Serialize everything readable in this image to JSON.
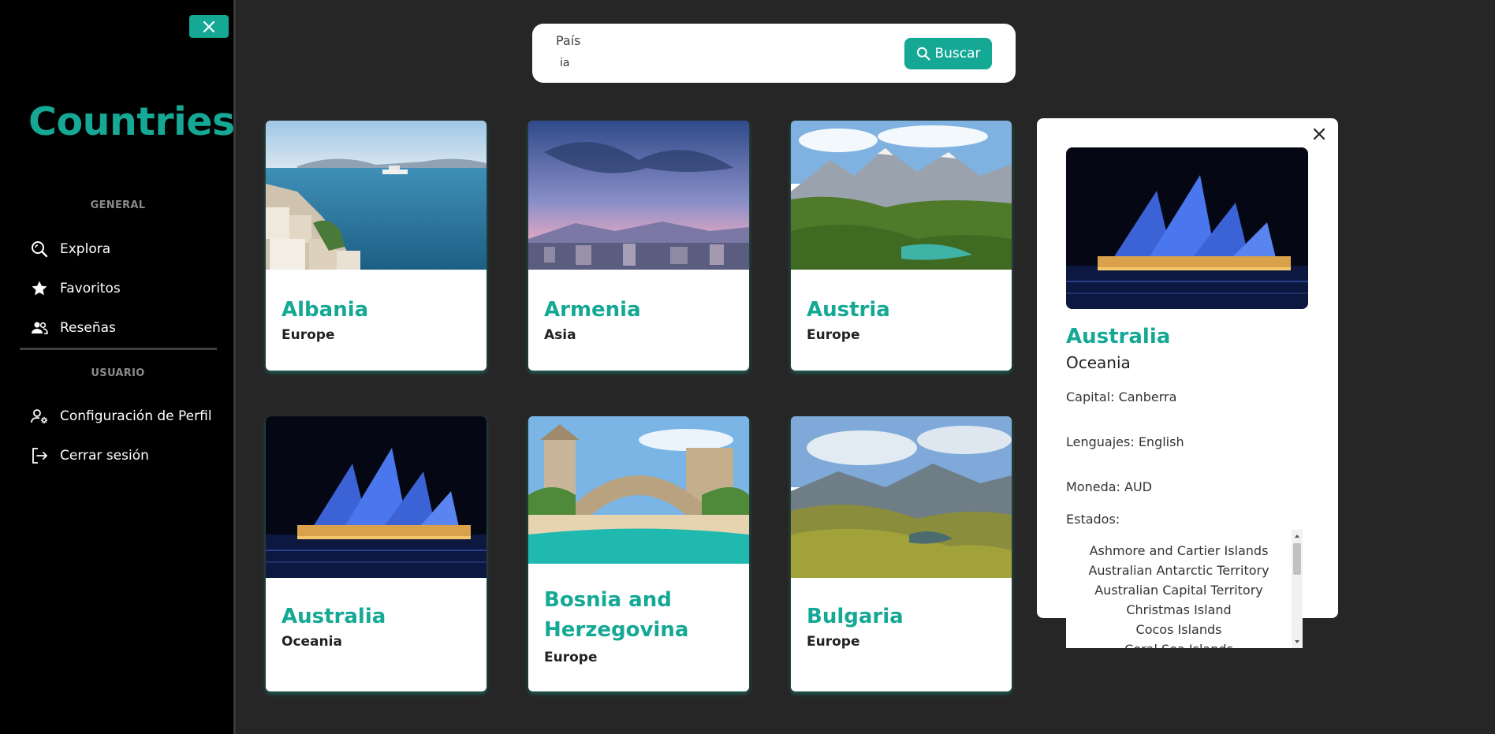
{
  "sidebar": {
    "brand": "Countries",
    "sections": {
      "general": "GENERAL",
      "user": "USUARIO"
    },
    "items": [
      {
        "label": "Explora",
        "icon": "explore-search-icon"
      },
      {
        "label": "Favoritos",
        "icon": "star-icon"
      },
      {
        "label": "Reseñas",
        "icon": "people-icon"
      },
      {
        "label": "Configuración de Perfil",
        "icon": "user-settings-icon"
      },
      {
        "label": "Cerrar sesión",
        "icon": "logout-icon"
      }
    ]
  },
  "search": {
    "label": "País",
    "value": "ia",
    "button_label": "Buscar"
  },
  "cards": [
    {
      "name": "Albania",
      "region": "Europe"
    },
    {
      "name": "Armenia",
      "region": "Asia"
    },
    {
      "name": "Austria",
      "region": "Europe"
    },
    {
      "name": "Australia",
      "region": "Oceania"
    },
    {
      "name": "Bosnia and Herzegovina",
      "name_line1": "Bosnia and",
      "name_line2": "Herzegovina",
      "region": "Europe"
    },
    {
      "name": "Bulgaria",
      "region": "Europe"
    }
  ],
  "detail": {
    "name": "Australia",
    "region": "Oceania",
    "capital": "Capital: Canberra",
    "languages": "Lenguajes: English",
    "currency": "Moneda: AUD",
    "states_label": "Estados:",
    "states": [
      "Ashmore and Cartier Islands",
      "Australian Antarctic Territory",
      "Australian Capital Territory",
      "Christmas Island",
      "Cocos Islands",
      "Coral Sea Islands"
    ]
  },
  "colors": {
    "accent": "#14a895",
    "background": "#262626",
    "sidebar": "#000000"
  }
}
